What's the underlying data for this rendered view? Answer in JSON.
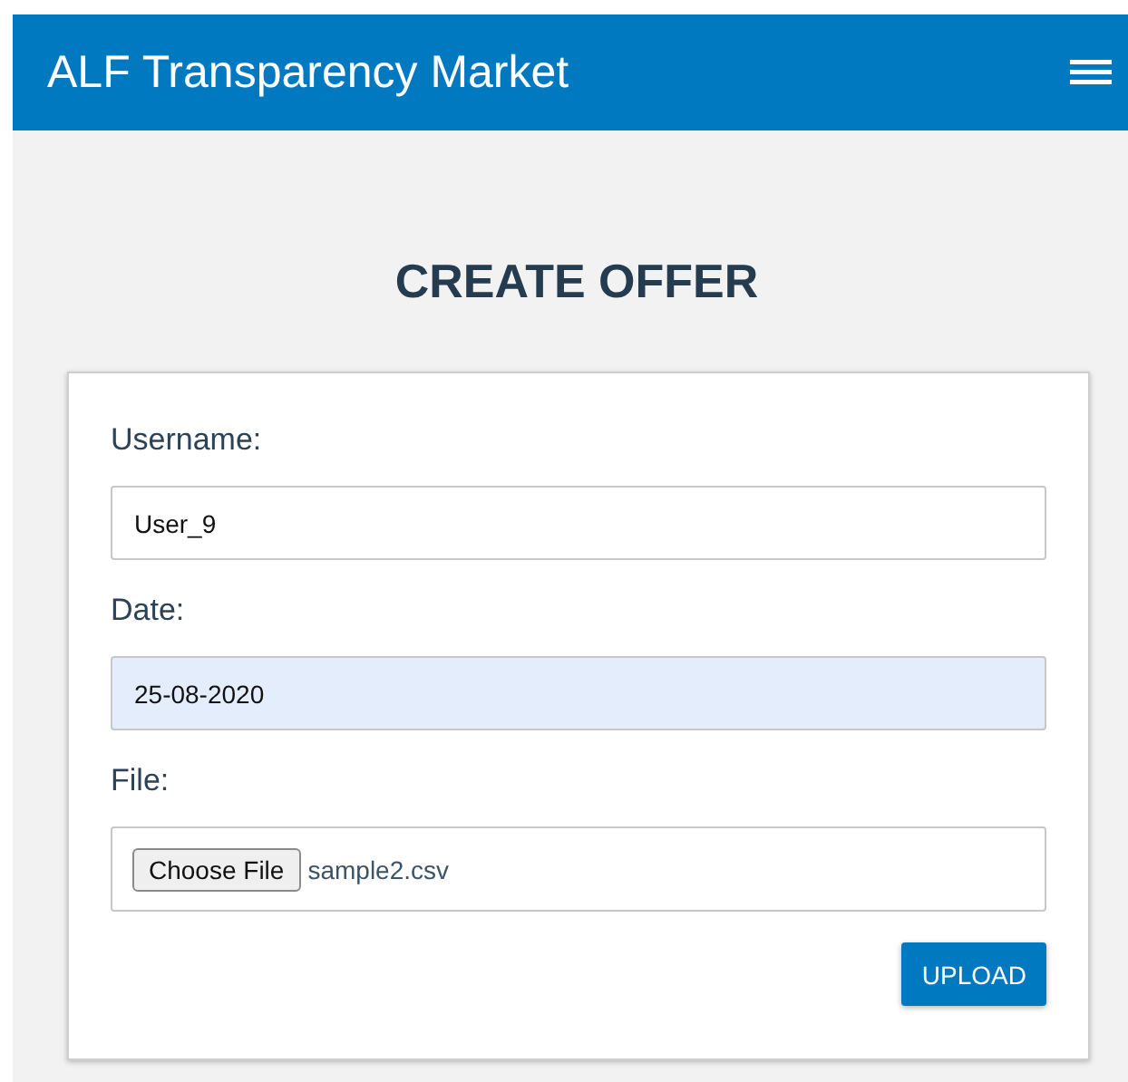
{
  "header": {
    "title": "ALF Transparency Market"
  },
  "page": {
    "heading": "CREATE OFFER"
  },
  "form": {
    "fields": [
      {
        "kind": "text",
        "label": "Username:",
        "value": "User_9",
        "autofilled": false
      },
      {
        "kind": "text",
        "label": "Date:",
        "value": "25-08-2020",
        "autofilled": true
      },
      {
        "kind": "file",
        "label": "File:",
        "button": "Choose File",
        "value": "sample2.csv"
      }
    ],
    "submit": "UPLOAD"
  }
}
